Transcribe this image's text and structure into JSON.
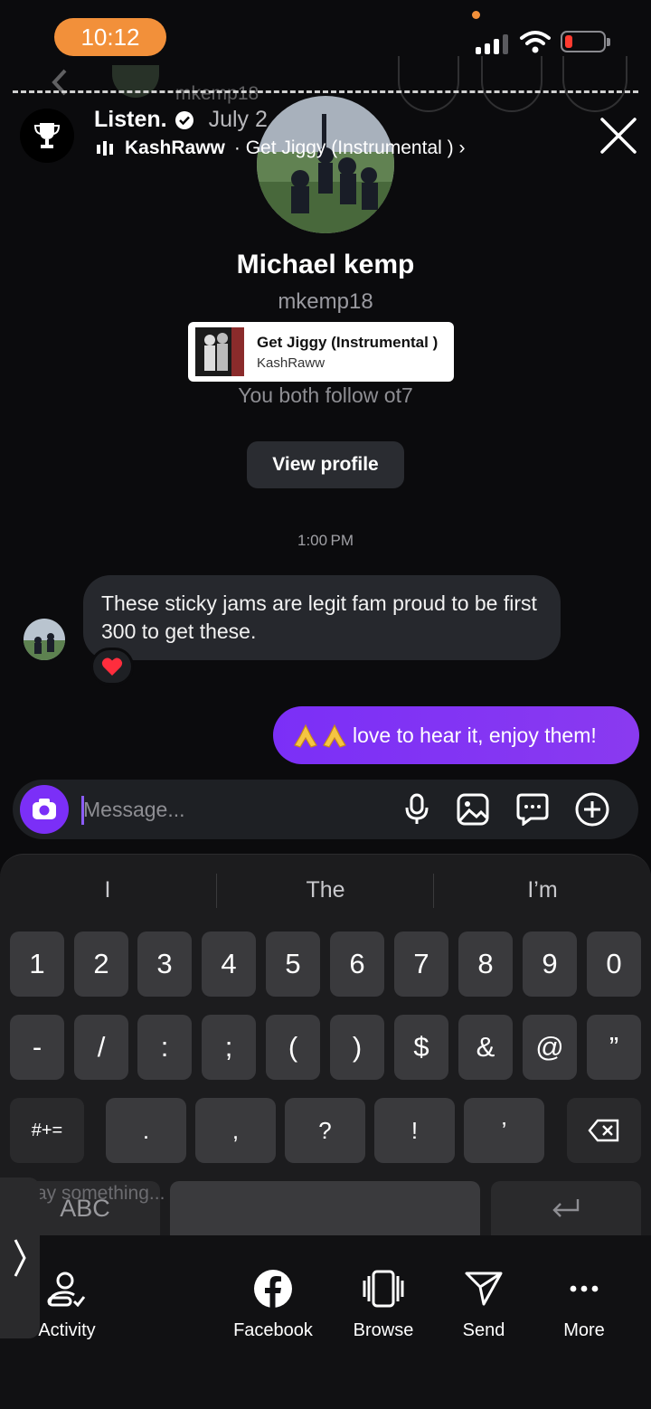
{
  "status_bar": {
    "time": "10:12"
  },
  "story_header": {
    "username": "Listen.",
    "date": "July 2",
    "artist": "KashRaww",
    "song": "· Get Jiggy (Instrumental ) ›"
  },
  "profile": {
    "name": "Michael kemp",
    "handle": "mkemp18",
    "music_sticker": {
      "title": "Get Jiggy (Instrumental )",
      "artist": "KashRaww"
    },
    "mutual": "You both follow ot7",
    "view_profile_label": "View profile"
  },
  "conversation": {
    "timestamp": "1:00 PM",
    "incoming_message": "These sticky jams are legit fam proud to be first 300 to get these.",
    "reaction": "heart",
    "outgoing_message": "love to hear it, enjoy them!"
  },
  "composer": {
    "placeholder": "Message..."
  },
  "keyboard": {
    "suggestions": [
      "I",
      "The",
      "I’m"
    ],
    "row1": [
      "1",
      "2",
      "3",
      "4",
      "5",
      "6",
      "7",
      "8",
      "9",
      "0"
    ],
    "row2": [
      "-",
      "/",
      ":",
      ";",
      "(",
      ")",
      "$",
      "&",
      "@",
      "”"
    ],
    "row3": {
      "shift": "#+=",
      "keys": [
        ".",
        ",",
        "?",
        "!",
        "’"
      ]
    },
    "abc_label": "ABC",
    "ghost_text": "ay something..."
  },
  "bottom_actions": [
    {
      "label": "Activity",
      "icon": "activity-icon"
    },
    {
      "label": "Facebook",
      "icon": "facebook-icon"
    },
    {
      "label": "Browse",
      "icon": "browse-icon"
    },
    {
      "label": "Send",
      "icon": "send-icon"
    },
    {
      "label": "More",
      "icon": "more-icon"
    }
  ],
  "colors": {
    "accent": "#7b2ff7",
    "time_pill": "#f2903a",
    "battery_low": "#ff3b30"
  }
}
